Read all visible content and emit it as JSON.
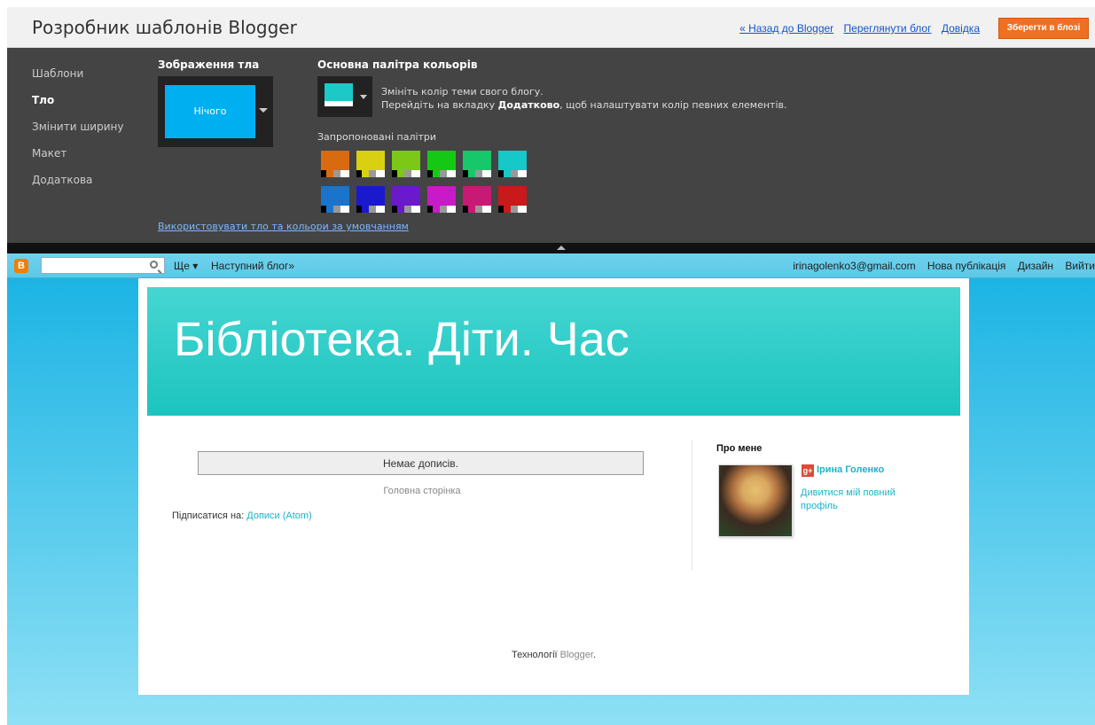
{
  "app": {
    "title": "Розробник шаблонів Blogger",
    "links": [
      "« Назад до Blogger",
      "Переглянути блог",
      "Довідка"
    ],
    "save_label": "Зберегти в блозі"
  },
  "panel": {
    "nav": [
      {
        "label": "Шаблони",
        "active": false
      },
      {
        "label": "Тло",
        "active": true
      },
      {
        "label": "Змінити ширину",
        "active": false
      },
      {
        "label": "Макет",
        "active": false
      },
      {
        "label": "Додаткова",
        "active": false
      }
    ],
    "background": {
      "title": "Зображення тла",
      "value": "Нічого"
    },
    "palette": {
      "title": "Основна палітра кольорів",
      "desc_line1": "Змініть колір теми свого блогу.",
      "desc_line2_pre": "Перейдіть на вкладку ",
      "desc_line2_bold": "Додатково",
      "desc_line2_post": ", щоб налаштувати колір певних елементів.",
      "suggested_label": "Запропоновані палітри",
      "swatches": [
        "#d86a10",
        "#d8d010",
        "#7cc816",
        "#16c816",
        "#16c86a",
        "#16c8c8",
        "#1a74cc",
        "#1a1acc",
        "#6a1acc",
        "#c81ac8",
        "#c81a74",
        "#c81a1a"
      ]
    },
    "default_link": "Використовувати тло та кольори за умовчанням"
  },
  "navbar": {
    "more": "Ще ▾",
    "next_blog": "Наступний блог»",
    "email": "irinagolenko3@gmail.com",
    "new_post": "Нова публікація",
    "design": "Дизайн",
    "logout": "Вийти"
  },
  "blog": {
    "title": "Бібліотека. Діти. Час",
    "no_posts": "Немає дописів.",
    "home": "Головна сторінка",
    "subscribe_pre": "Підписатися на: ",
    "subscribe_link": "Дописи (Atom)",
    "about_title": "Про мене",
    "author": "Ірина Голенко",
    "profile_link": "Дивитися мій повний профіль",
    "powered_pre": "Технології ",
    "powered_link": "Blogger",
    "powered_post": "."
  }
}
